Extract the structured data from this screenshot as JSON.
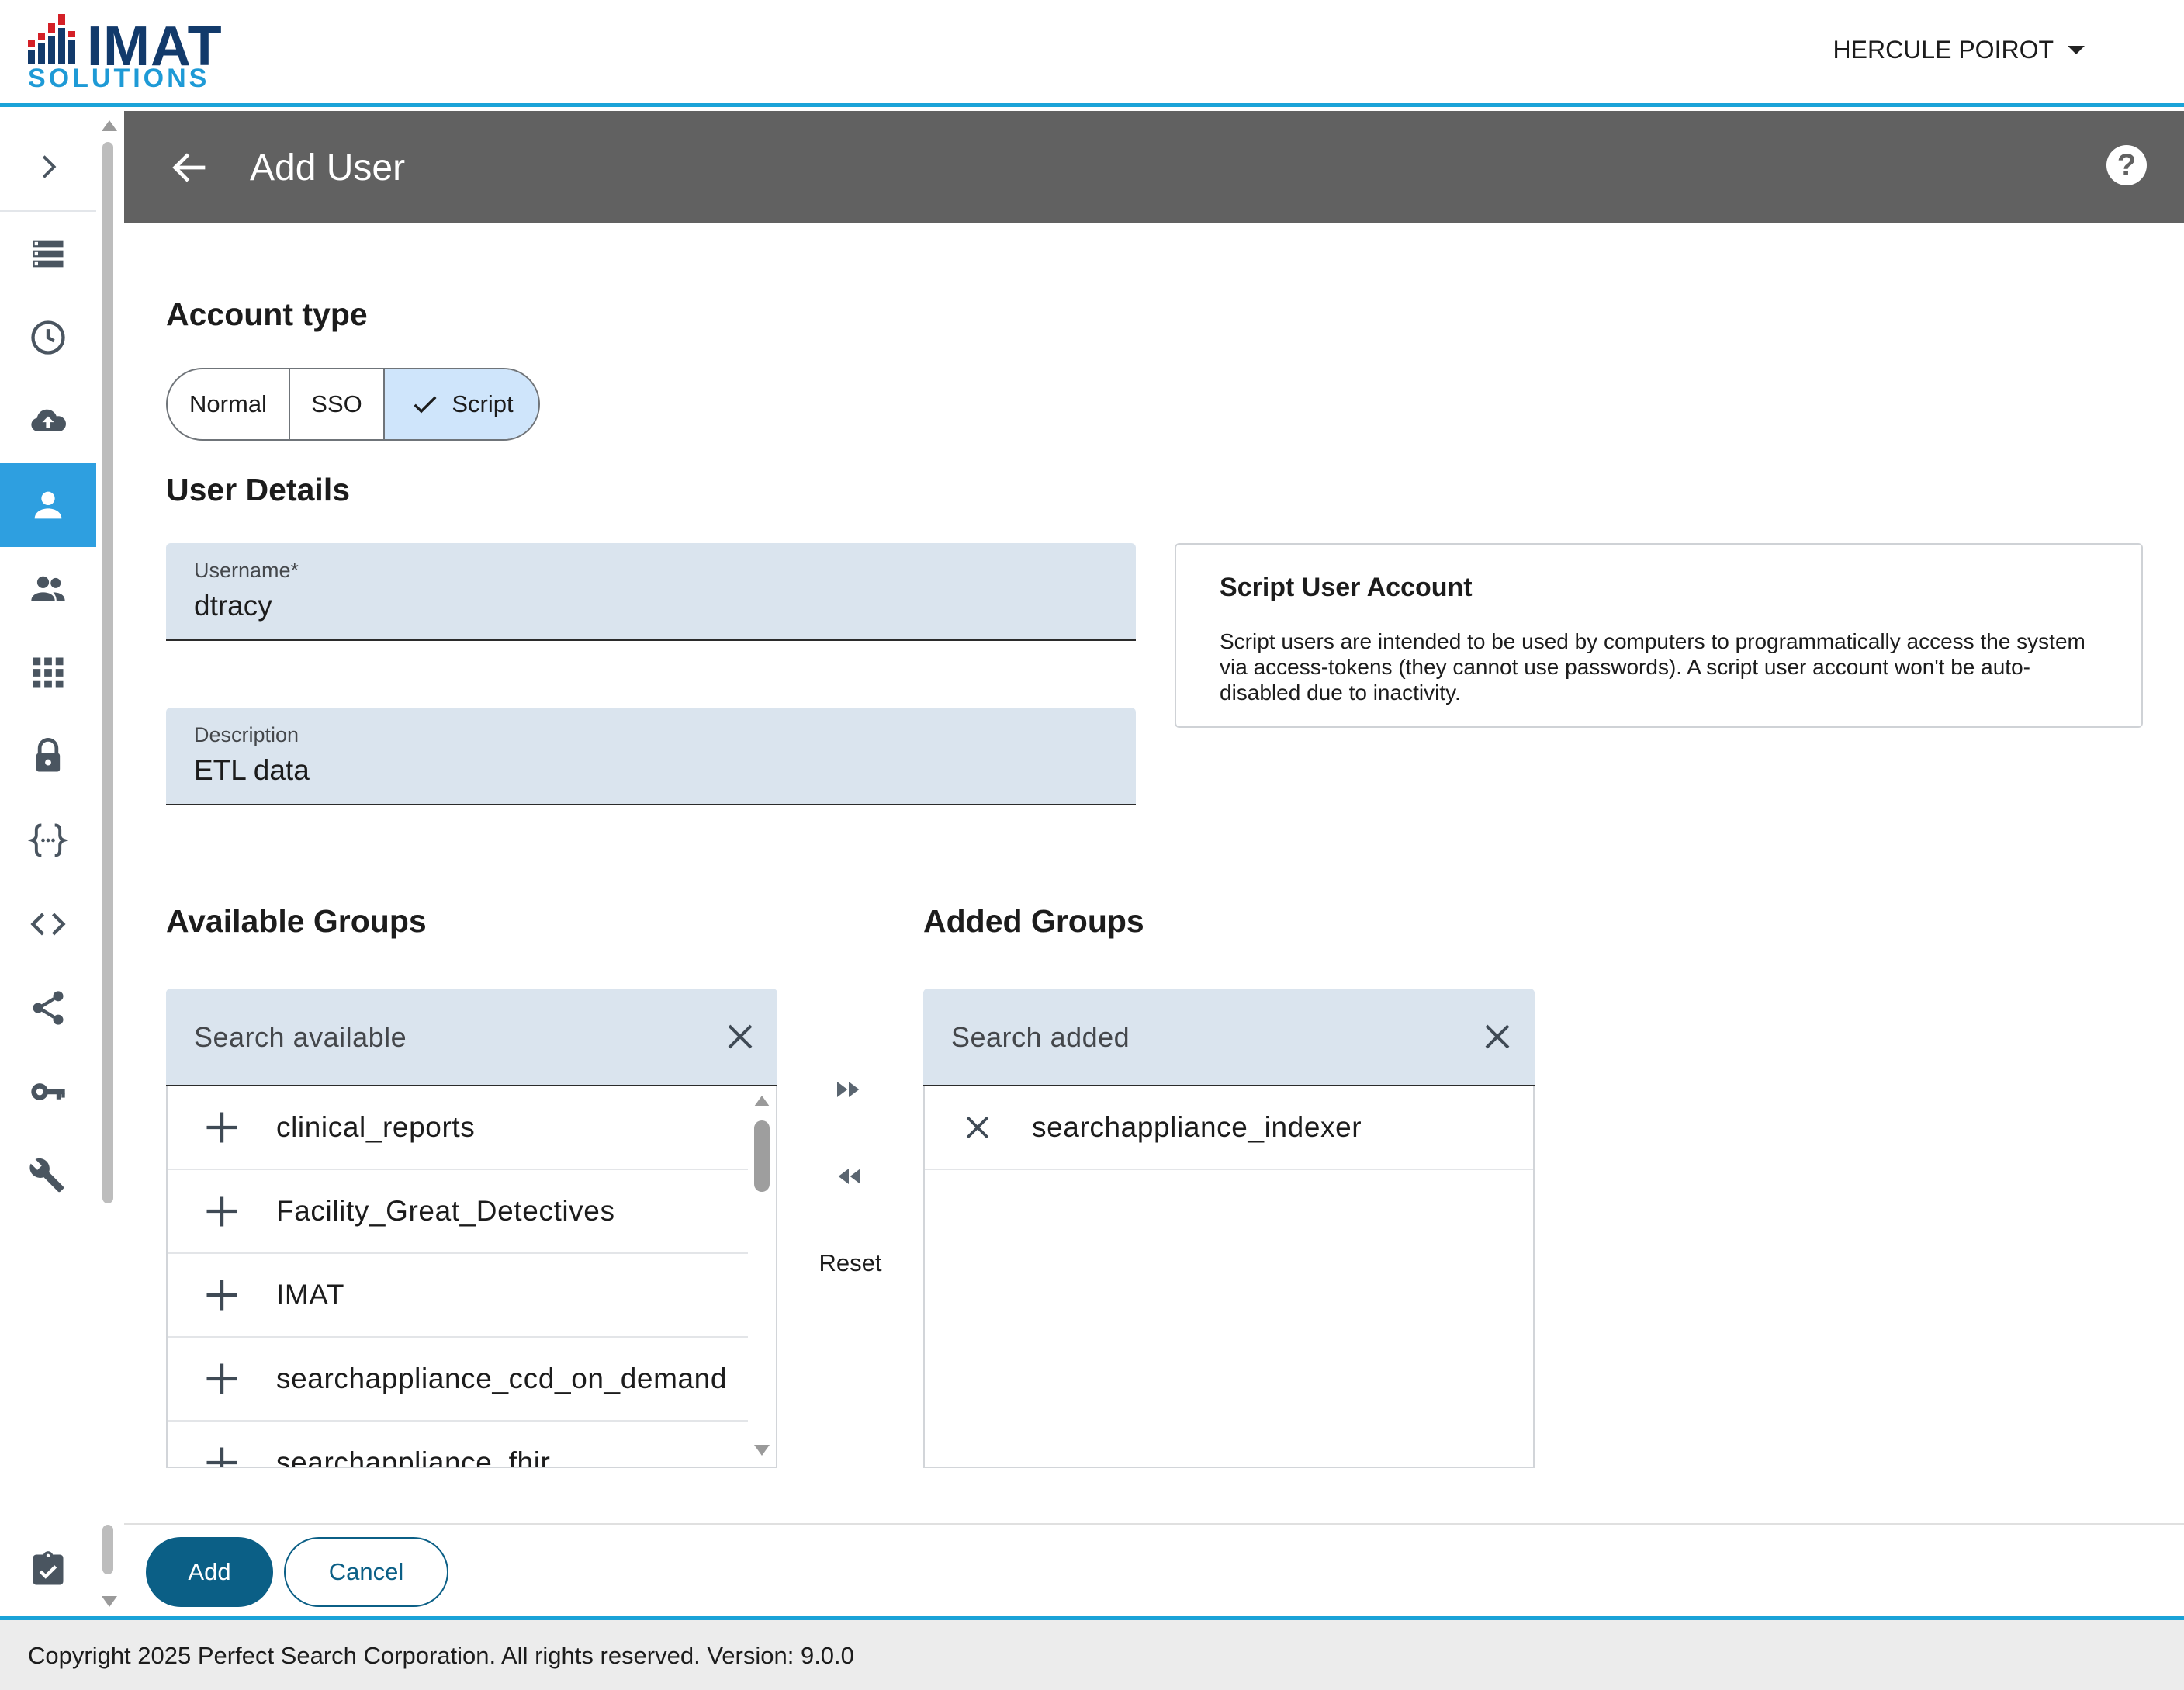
{
  "brand": {
    "name_top": "IMAT",
    "name_bottom": "SOLUTIONS",
    "primary_color": "#123a6b",
    "accent_color": "#1e9ad6",
    "logo_red": "#d42027"
  },
  "user_menu": {
    "name": "HERCULE POIROT"
  },
  "nav": {
    "expand_icon": "chevron-right-icon",
    "items": [
      {
        "icon": "list-icon",
        "active": false
      },
      {
        "icon": "clock-icon",
        "active": false
      },
      {
        "icon": "cloud-upload-icon",
        "active": false
      },
      {
        "icon": "person-icon",
        "active": true
      },
      {
        "icon": "people-icon",
        "active": false
      },
      {
        "icon": "grid-icon",
        "active": false
      },
      {
        "icon": "lock-icon",
        "active": false
      },
      {
        "icon": "braces-icon",
        "active": false
      },
      {
        "icon": "code-icon",
        "active": false
      },
      {
        "icon": "share-icon",
        "active": false
      },
      {
        "icon": "key-icon",
        "active": false
      },
      {
        "icon": "wrench-icon",
        "active": false
      },
      {
        "icon": "clipboard-check-icon",
        "active": false
      }
    ]
  },
  "header": {
    "title": "Add User",
    "help_glyph": "?"
  },
  "account_type": {
    "heading": "Account type",
    "options": [
      "Normal",
      "SSO",
      "Script"
    ],
    "selected": "Script"
  },
  "user_details": {
    "heading": "User Details",
    "username": {
      "label": "Username*",
      "value": "dtracy"
    },
    "description": {
      "label": "Description",
      "value": "ETL data"
    }
  },
  "info_card": {
    "title": "Script User Account",
    "text": "Script users are intended to be used by computers to programmatically access the system via access-tokens (they cannot use passwords). A script user account won't be auto-disabled due to inactivity."
  },
  "available_groups": {
    "heading": "Available Groups",
    "search_placeholder": "Search available",
    "items": [
      "clinical_reports",
      "Facility_Great_Detectives",
      "IMAT",
      "searchappliance_ccd_on_demand",
      "searchappliance_fhir"
    ]
  },
  "added_groups": {
    "heading": "Added Groups",
    "search_placeholder": "Search added",
    "items": [
      "searchappliance_indexer"
    ]
  },
  "transfer": {
    "reset_label": "Reset"
  },
  "actions": {
    "add_label": "Add",
    "cancel_label": "Cancel"
  },
  "footer": {
    "copyright": "Copyright 2025 Perfect Search Corporation. All rights reserved. Version: 9.0.0"
  }
}
